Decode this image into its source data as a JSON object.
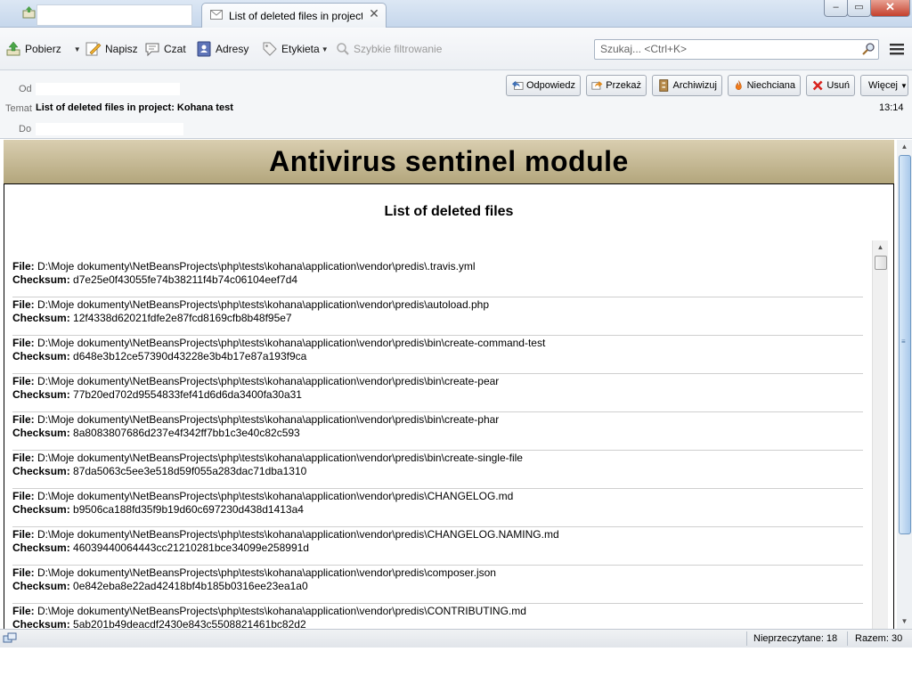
{
  "titlebar": {
    "tab_title": "List of deleted files in project...",
    "tab_close": "✕",
    "minimize": "–",
    "maximize": "▭",
    "close": "✕"
  },
  "toolbar": {
    "get_mail": "Pobierz",
    "write": "Napisz",
    "chat": "Czat",
    "address_book": "Adresy",
    "tag": "Etykieta",
    "quick_filter": "Szybkie filtrowanie",
    "search_placeholder": "Szukaj... <Ctrl+K>"
  },
  "header": {
    "from_label": "Od",
    "subject_label": "Temat",
    "subject": "List of deleted files in project: Kohana test",
    "to_label": "Do",
    "time": "13:14",
    "buttons": {
      "reply": "Odpowiedz",
      "forward": "Przekaż",
      "archive": "Archiwizuj",
      "junk": "Niechciana",
      "delete": "Usuń",
      "more": "Więcej"
    }
  },
  "message": {
    "banner": "Antivirus sentinel module",
    "subtitle": "List of deleted files",
    "file_label": "File:",
    "checksum_label": "Checksum:",
    "entries": [
      {
        "file": "D:\\Moje dokumenty\\NetBeansProjects\\php\\tests\\kohana\\application\\vendor\\predis\\.travis.yml",
        "checksum": "d7e25e0f43055fe74b38211f4b74c06104eef7d4"
      },
      {
        "file": "D:\\Moje dokumenty\\NetBeansProjects\\php\\tests\\kohana\\application\\vendor\\predis\\autoload.php",
        "checksum": "12f4338d62021fdfe2e87fcd8169cfb8b48f95e7"
      },
      {
        "file": "D:\\Moje dokumenty\\NetBeansProjects\\php\\tests\\kohana\\application\\vendor\\predis\\bin\\create-command-test",
        "checksum": "d648e3b12ce57390d43228e3b4b17e87a193f9ca"
      },
      {
        "file": "D:\\Moje dokumenty\\NetBeansProjects\\php\\tests\\kohana\\application\\vendor\\predis\\bin\\create-pear",
        "checksum": "77b20ed702d9554833fef41d6d6da3400fa30a31"
      },
      {
        "file": "D:\\Moje dokumenty\\NetBeansProjects\\php\\tests\\kohana\\application\\vendor\\predis\\bin\\create-phar",
        "checksum": "8a8083807686d237e4f342ff7bb1c3e40c82c593"
      },
      {
        "file": "D:\\Moje dokumenty\\NetBeansProjects\\php\\tests\\kohana\\application\\vendor\\predis\\bin\\create-single-file",
        "checksum": "87da5063c5ee3e518d59f055a283dac71dba1310"
      },
      {
        "file": "D:\\Moje dokumenty\\NetBeansProjects\\php\\tests\\kohana\\application\\vendor\\predis\\CHANGELOG.md",
        "checksum": "b9506ca188fd35f9b19d60c697230d438d1413a4"
      },
      {
        "file": "D:\\Moje dokumenty\\NetBeansProjects\\php\\tests\\kohana\\application\\vendor\\predis\\CHANGELOG.NAMING.md",
        "checksum": "46039440064443cc21210281bce34099e258991d"
      },
      {
        "file": "D:\\Moje dokumenty\\NetBeansProjects\\php\\tests\\kohana\\application\\vendor\\predis\\composer.json",
        "checksum": "0e842eba8e22ad42418bf4b185b0316ee23ea1a0"
      },
      {
        "file": "D:\\Moje dokumenty\\NetBeansProjects\\php\\tests\\kohana\\application\\vendor\\predis\\CONTRIBUTING.md",
        "checksum": "5ab201b49deacdf2430e843c5508821461bc82d2"
      }
    ]
  },
  "statusbar": {
    "unread": "Nieprzeczytane: 18",
    "total": "Razem: 30"
  },
  "colors": {
    "banner": "#c4b88f",
    "titlebar": "#c6d7ec",
    "close_button": "#c4402c"
  }
}
